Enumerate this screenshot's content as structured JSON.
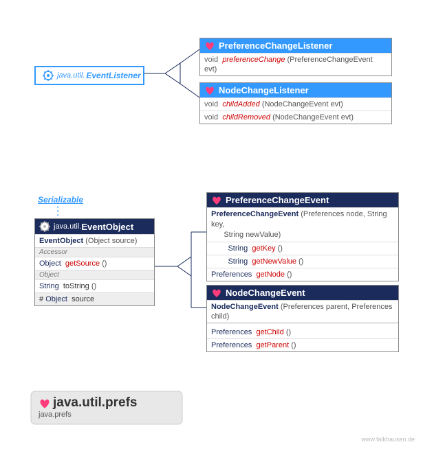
{
  "eventListener": {
    "pkg": "java.util.",
    "name": "EventListener"
  },
  "pcl": {
    "title": "PreferenceChangeListener",
    "m1": {
      "ret": "void",
      "name": "preferenceChange",
      "args": "(PreferenceChangeEvent evt)"
    }
  },
  "ncl": {
    "title": "NodeChangeListener",
    "m1": {
      "ret": "void",
      "name": "childAdded",
      "args": "(NodeChangeEvent evt)"
    },
    "m2": {
      "ret": "void",
      "name": "childRemoved",
      "args": "(NodeChangeEvent evt)"
    }
  },
  "serializable": "Serializable",
  "eventObject": {
    "pkg": "java.util.",
    "name": "EventObject",
    "ctor": {
      "name": "EventObject",
      "args": "(Object source)"
    },
    "accLabel": "Accessor",
    "m1": {
      "ret": "Object",
      "name": "getSource",
      "args": "()"
    },
    "objLabel": "Object",
    "m2": {
      "ret": "String",
      "name": "toString",
      "args": "()"
    },
    "field": {
      "vis": "#",
      "type": "Object",
      "name": "source"
    }
  },
  "pce": {
    "title": "PreferenceChangeEvent",
    "ctor": {
      "name": "PreferenceChangeEvent",
      "args1": "(Preferences node, String key,",
      "args2": "String newValue)"
    },
    "m1": {
      "ret": "String",
      "name": "getKey",
      "args": "()"
    },
    "m2": {
      "ret": "String",
      "name": "getNewValue",
      "args": "()"
    },
    "m3": {
      "ret": "Preferences",
      "name": "getNode",
      "args": "()"
    }
  },
  "nce": {
    "title": "NodeChangeEvent",
    "ctor": {
      "name": "NodeChangeEvent",
      "args": "(Preferences parent, Preferences child)"
    },
    "m1": {
      "ret": "Preferences",
      "name": "getChild",
      "args": "()"
    },
    "m2": {
      "ret": "Preferences",
      "name": "getParent",
      "args": "()"
    }
  },
  "package": {
    "title": "java.util.prefs",
    "sub": "java.prefs"
  },
  "credit": "www.falkhausen.de"
}
